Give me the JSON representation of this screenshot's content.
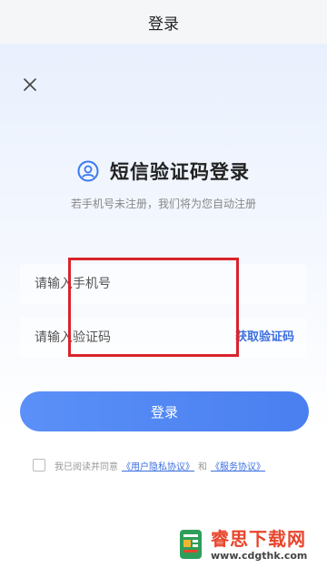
{
  "header": {
    "title": "登录"
  },
  "main": {
    "title": "短信验证码登录",
    "subtitle": "若手机号未注册，我们将为您自动注册",
    "phone_input": {
      "placeholder": "请输入手机号",
      "value": ""
    },
    "code_input": {
      "placeholder": "请输入验证码",
      "value": ""
    },
    "get_code_label": "获取验证码",
    "login_label": "登录",
    "agreement": {
      "text_before": "我已阅读并同意",
      "privacy_link": "《用户隐私协议》",
      "conjunction": "和",
      "service_link": "《服务协议》"
    }
  },
  "icons": {
    "close": "close-icon",
    "user": "user-circle-icon"
  },
  "colors": {
    "accent": "#3b6fe0",
    "button": "#4a7ff0",
    "annotation": "#d9232b",
    "watermark": "#e8452c"
  },
  "watermark": {
    "name": "睿思下载网",
    "url": "www.cdgthk.com"
  }
}
